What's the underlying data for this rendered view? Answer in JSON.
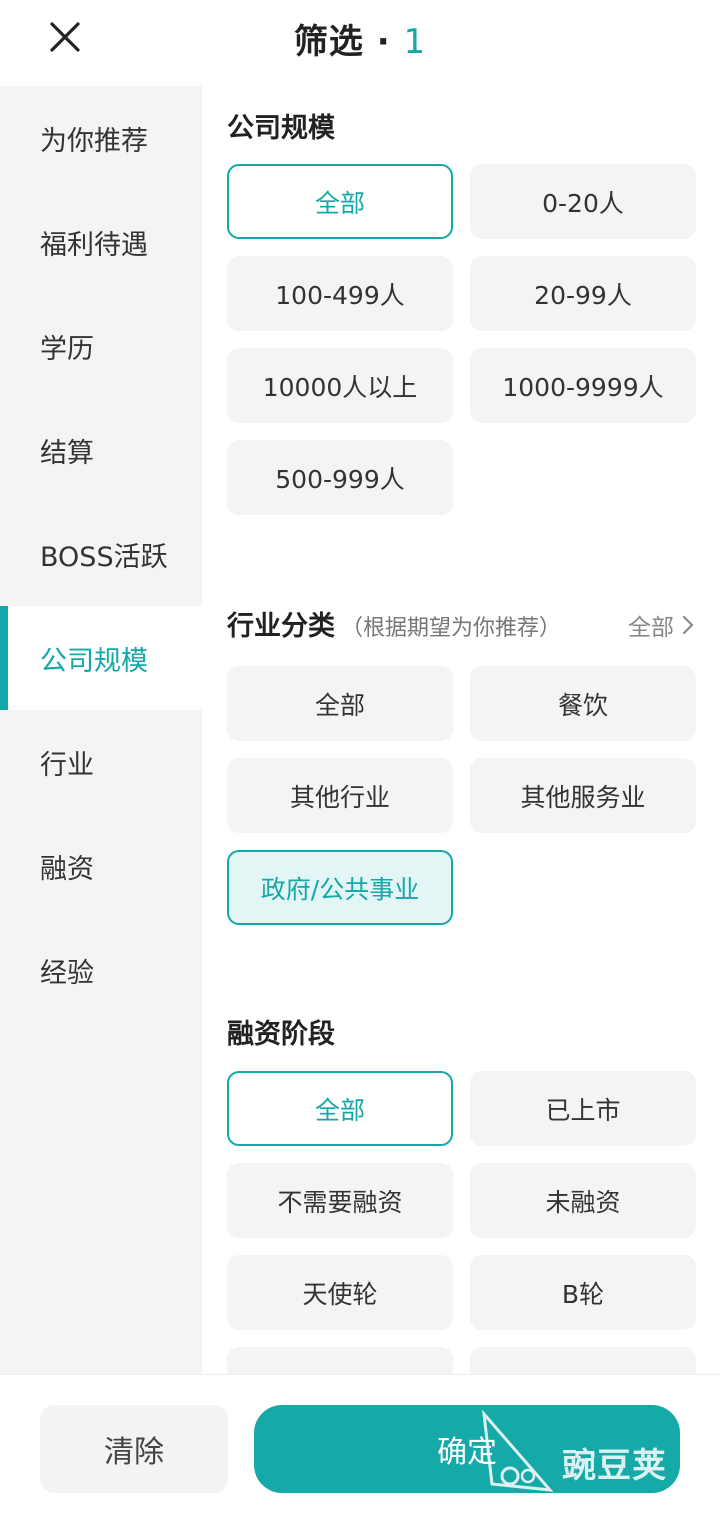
{
  "header": {
    "title": "筛选 · ",
    "count": "1"
  },
  "sidebar": {
    "items": [
      {
        "label": "为你推荐"
      },
      {
        "label": "福利待遇"
      },
      {
        "label": "学历"
      },
      {
        "label": "结算"
      },
      {
        "label": "BOSS活跃"
      },
      {
        "label": "公司规模",
        "active": true
      },
      {
        "label": "行业"
      },
      {
        "label": "融资"
      },
      {
        "label": "经验"
      }
    ]
  },
  "sections": {
    "company_size": {
      "title": "公司规模",
      "options": [
        "全部",
        "0-20人",
        "100-499人",
        "20-99人",
        "10000人以上",
        "1000-9999人",
        "500-999人"
      ],
      "selected": "全部"
    },
    "industry": {
      "title": "行业分类",
      "subtitle": "（根据期望为你推荐）",
      "more": "全部",
      "options": [
        "全部",
        "餐饮",
        "其他行业",
        "其他服务业",
        "政府/公共事业"
      ],
      "selected": "政府/公共事业"
    },
    "funding": {
      "title": "融资阶段",
      "options": [
        "全部",
        "已上市",
        "不需要融资",
        "未融资",
        "天使轮",
        "B轮"
      ],
      "selected": "全部"
    }
  },
  "footer": {
    "clear_label": "清除",
    "confirm_label": "确定"
  },
  "watermark": {
    "text": "豌豆荚"
  },
  "colors": {
    "accent": "#14a8aa",
    "sidebar_bg": "#f4f4f4",
    "option_bg": "#f4f4f4"
  }
}
